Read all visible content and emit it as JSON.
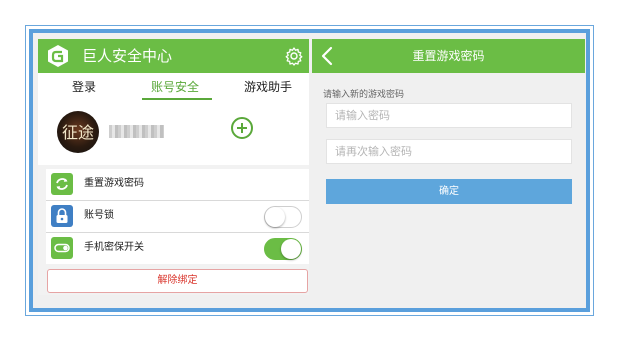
{
  "left_panel": {
    "app_title": "巨人安全中心",
    "logo_icon": "giant-logo-icon",
    "settings_icon": "gear-icon",
    "tabs": [
      {
        "label": "登录",
        "active": false
      },
      {
        "label": "账号安全",
        "active": true
      },
      {
        "label": "游戏助手",
        "active": false
      }
    ],
    "profile": {
      "avatar_text": "征途",
      "add_icon": "plus-circle-icon"
    },
    "settings_rows": [
      {
        "label": "重置游戏密码",
        "icon": "refresh-icon",
        "icon_color": "#6bbd45",
        "toggle": null
      },
      {
        "label": "账号锁",
        "icon": "padlock-icon",
        "icon_color": "#3f7fc4",
        "toggle": "off"
      },
      {
        "label": "手机密保开关",
        "icon": "switch-icon",
        "icon_color": "#6bbd45",
        "toggle": "on"
      }
    ],
    "unbind_label": "解除绑定"
  },
  "right_panel": {
    "title": "重置游戏密码",
    "back_icon": "chevron-left-icon",
    "hint": "请输入新的游戏密码",
    "new_password_placeholder": "请输入密码",
    "confirm_password_placeholder": "请再次输入密码",
    "confirm_label": "确定"
  },
  "colors": {
    "brand_green": "#6bbd45",
    "accent_blue": "#5ea6dc",
    "danger_red": "#d9342b",
    "frame_blue": "#5a9fdc"
  }
}
